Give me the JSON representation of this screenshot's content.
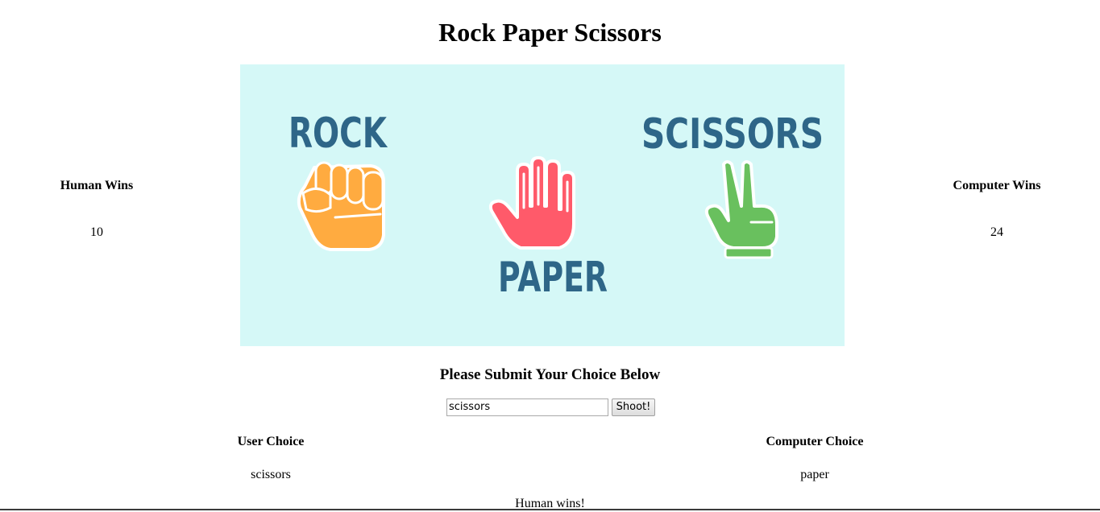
{
  "title": "Rock Paper Scissors",
  "scoreboard": {
    "human_label": "Human Wins",
    "human_value": "10",
    "computer_label": "Computer Wins",
    "computer_value": "24"
  },
  "banner": {
    "rock_word": "ROCK",
    "paper_word": "PAPER",
    "scissors_word": "SCISSORS",
    "colors": {
      "background": "#d5f8f7",
      "text": "#2e6688",
      "rock": "#ffab40",
      "paper": "#ff5a6a",
      "scissors": "#69c05e"
    },
    "icons": [
      "fist-icon",
      "open-hand-icon",
      "peace-sign-hand-icon"
    ]
  },
  "form": {
    "prompt": "Please Submit Your Choice Below",
    "input_value": "scissors",
    "submit_label": "Shoot!"
  },
  "choices": {
    "user_label": "User Choice",
    "user_value": "scissors",
    "computer_label": "Computer Choice",
    "computer_value": "paper"
  },
  "result": "Human wins!"
}
